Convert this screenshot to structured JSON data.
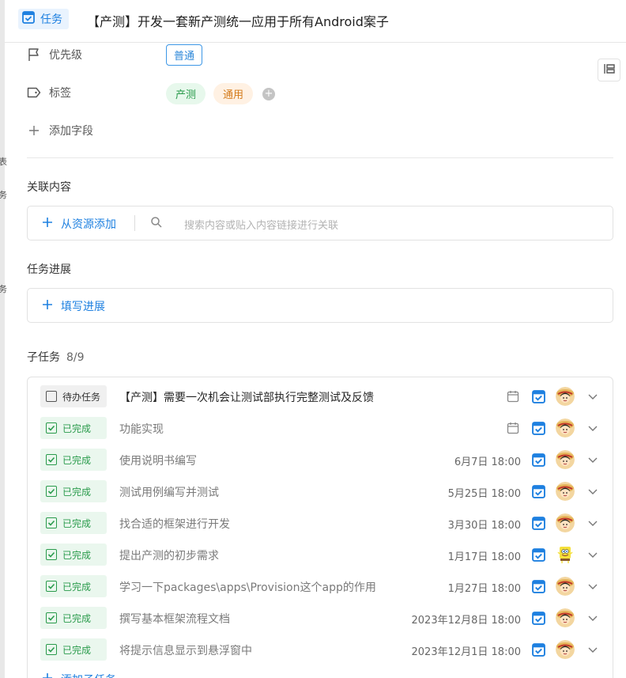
{
  "header": {
    "type_label": "任务",
    "title": "【产测】开发一套新产测统一应用于所有Android案子"
  },
  "fields": {
    "priority_label": "优先级",
    "priority_value": "普通",
    "tags_label": "标签",
    "tags": [
      "产测",
      "通用"
    ],
    "add_field_label": "添加字段"
  },
  "related": {
    "section_title": "关联内容",
    "add_label": "从资源添加",
    "search_placeholder": "搜索内容或贴入内容链接进行关联"
  },
  "progress": {
    "section_title": "任务进展",
    "add_label": "填写进展"
  },
  "subtasks": {
    "section_title": "子任务",
    "count": "8/9",
    "add_label": "添加子任务",
    "rows": [
      {
        "status": "待办任务",
        "title": "【产测】需要一次机会让测试部执行完整测试及反馈",
        "date": "",
        "done": false,
        "avatar": "luffy"
      },
      {
        "status": "已完成",
        "title": "功能实现",
        "date": "",
        "done": true,
        "avatar": "luffy"
      },
      {
        "status": "已完成",
        "title": "使用说明书编写",
        "date": "6月7日 18:00",
        "done": true,
        "avatar": "luffy"
      },
      {
        "status": "已完成",
        "title": "测试用例编写并测试",
        "date": "5月25日 18:00",
        "done": true,
        "avatar": "luffy"
      },
      {
        "status": "已完成",
        "title": "找合适的框架进行开发",
        "date": "3月30日 18:00",
        "done": true,
        "avatar": "luffy"
      },
      {
        "status": "已完成",
        "title": "提出产测的初步需求",
        "date": "1月17日 18:00",
        "done": true,
        "avatar": "sponge"
      },
      {
        "status": "已完成",
        "title": "学习一下packages\\apps\\Provision这个app的作用",
        "date": "1月27日 18:00",
        "done": true,
        "avatar": "luffy"
      },
      {
        "status": "已完成",
        "title": "撰写基本框架流程文档",
        "date": "2023年12月8日 18:00",
        "done": true,
        "avatar": "luffy"
      },
      {
        "status": "已完成",
        "title": "将提示信息显示到悬浮窗中",
        "date": "2023年12月1日 18:00",
        "done": true,
        "avatar": "luffy"
      }
    ]
  },
  "colors": {
    "accent": "#1e80e0",
    "done_green": "#2a9b4c",
    "tag_green_bg": "#e7f8ec",
    "tag_orange_bg": "#fff1e3"
  }
}
